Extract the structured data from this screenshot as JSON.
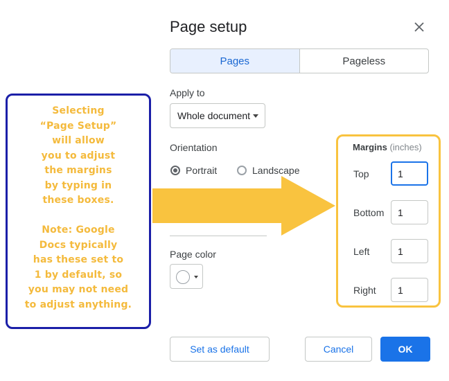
{
  "dialog": {
    "title": "Page setup",
    "close_icon": "close-icon"
  },
  "tabs": [
    {
      "label": "Pages",
      "active": true
    },
    {
      "label": "Pageless",
      "active": false
    }
  ],
  "apply_to": {
    "label": "Apply to",
    "value": "Whole document"
  },
  "orientation": {
    "label": "Orientation",
    "options": [
      {
        "label": "Portrait",
        "selected": true
      },
      {
        "label": "Landscape",
        "selected": false
      }
    ]
  },
  "page_color": {
    "label": "Page color",
    "value": "#ffffff"
  },
  "margins": {
    "title": "Margins",
    "unit": "(inches)",
    "fields": [
      {
        "label": "Top",
        "value": "1"
      },
      {
        "label": "Bottom",
        "value": "1"
      },
      {
        "label": "Left",
        "value": "1"
      },
      {
        "label": "Right",
        "value": "1"
      }
    ]
  },
  "buttons": {
    "set_default": "Set as default",
    "cancel": "Cancel",
    "ok": "OK"
  },
  "annotation": {
    "lines": [
      "Selecting",
      "“Page Setup”",
      "will allow",
      "you to adjust",
      "the margins",
      "by typing in",
      "these boxes.",
      "",
      "Note: Google",
      "Docs typically",
      "has these set to",
      "1 by default, so",
      "you may not need",
      "to adjust anything."
    ],
    "text_color": "#f4ba3c",
    "border_color": "#1b1fa8",
    "arrow_color": "#f9c33f"
  },
  "colors": {
    "accent": "#1a73e8",
    "tab_active_bg": "#e8f0fe",
    "margins_highlight": "#f9c33f"
  }
}
